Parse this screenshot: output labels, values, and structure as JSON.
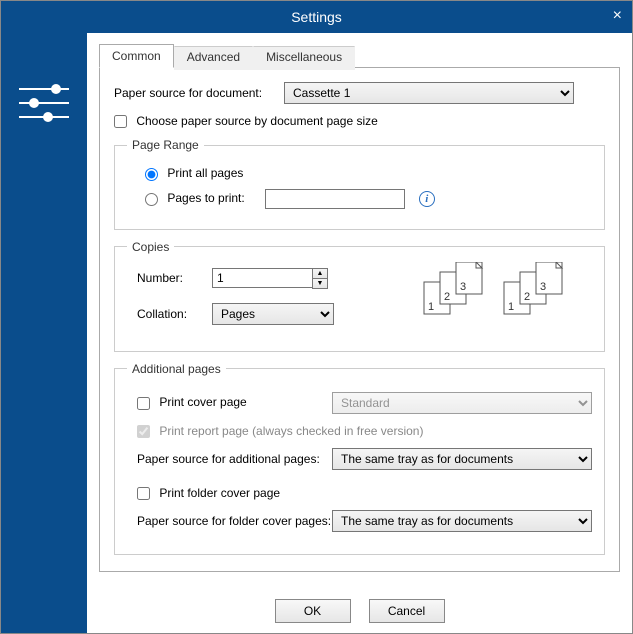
{
  "window": {
    "title": "Settings",
    "close": "×"
  },
  "tabs": {
    "common": "Common",
    "advanced": "Advanced",
    "misc": "Miscellaneous"
  },
  "paper_source": {
    "label": "Paper source for document:",
    "value": "Cassette 1"
  },
  "choose_by_size": {
    "label": "Choose paper source by document page size"
  },
  "page_range": {
    "legend": "Page Range",
    "all": "Print all pages",
    "pages": "Pages to print:",
    "pages_value": ""
  },
  "copies": {
    "legend": "Copies",
    "number_label": "Number:",
    "number_value": "1",
    "collation_label": "Collation:",
    "collation_value": "Pages"
  },
  "additional": {
    "legend": "Additional pages",
    "cover": "Print cover page",
    "cover_type": "Standard",
    "report": "Print report page (always checked in free version)",
    "source_additional_label": "Paper source for additional pages:",
    "source_additional_value": "The same tray as for documents",
    "folder_cover": "Print folder cover page",
    "source_folder_label": "Paper source for folder cover pages:",
    "source_folder_value": "The same tray as for documents"
  },
  "buttons": {
    "ok": "OK",
    "cancel": "Cancel"
  }
}
